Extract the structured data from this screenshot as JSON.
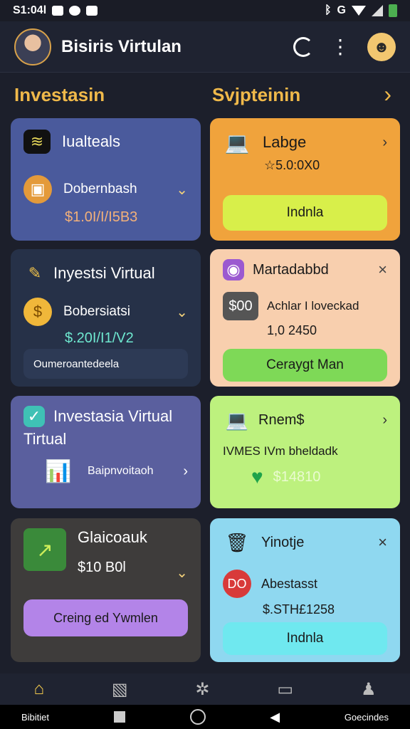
{
  "status": {
    "time": "S1:04l",
    "right": "G"
  },
  "header": {
    "title": "Bisiris Virtulan"
  },
  "sections": {
    "left": "Investasin",
    "right": "Svjpteinin",
    "arrow": "›"
  },
  "cards": {
    "c1": {
      "title": "Iualteals",
      "item": "Dobernbash",
      "amount": "$1.0I/I/I5B3",
      "chev": "⌄"
    },
    "c2": {
      "title": "Labge",
      "value": "5.0:0X0",
      "button": "Indnla",
      "chev": "›"
    },
    "c3": {
      "title": "Inyestsi Virtual",
      "item": "Bobersiatsi",
      "amount": "$.20I/I1/V2",
      "footer": "Oumeroantedeela",
      "chev": "⌄"
    },
    "c4": {
      "title": "Martadabbd",
      "icon_text": "$00",
      "line1": "Achlar I loveckad",
      "line2": "1,0 2450",
      "button": "Ceraygt Man",
      "close": "×"
    },
    "c5": {
      "title": "Investasia Virtual",
      "title2": "Tirtual",
      "item": "Baipnvoitaoh",
      "chev": "›"
    },
    "c6": {
      "title": "Rnem$",
      "line": "IVMES IVm bheldadk",
      "amount": "$14810",
      "chev": "›"
    },
    "c7": {
      "title": "Glaicoauk",
      "amount": "$10 B0l",
      "button": "Creing ed Ywmlen",
      "chev": "⌄"
    },
    "c8": {
      "title": "Yinotje",
      "icon_text": "DO",
      "item": "Abestasst",
      "amount": "$.STH£1258",
      "button": "Indnla",
      "close": "×"
    }
  },
  "sysnav": {
    "left": "Bibitiet",
    "right": "Goecindes"
  },
  "colors": {
    "accent": "#f0b94a",
    "c1": "#4a5a9c",
    "c2": "#f0a33c",
    "c3": "#263148",
    "c4": "#f8cfae",
    "c5": "#5a5f9e",
    "c6": "#bdf17e",
    "c7": "#3e3c3b",
    "c8": "#8fd8f0"
  }
}
